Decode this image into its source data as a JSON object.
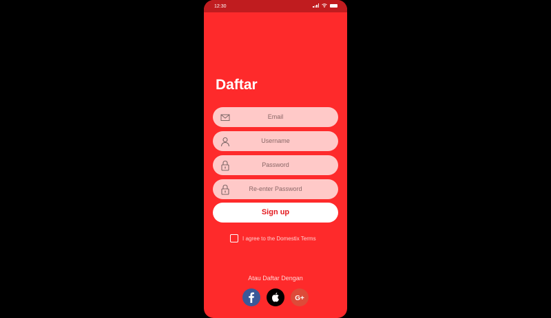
{
  "status": {
    "time": "12:30"
  },
  "screen": {
    "title": "Daftar"
  },
  "form": {
    "email_placeholder": "Email",
    "username_placeholder": "Username",
    "password_placeholder": "Password",
    "reenter_placeholder": "Re-enter Password",
    "signup_label": "Sign up",
    "agree_text": "I agree to the Domestix Terms"
  },
  "social": {
    "heading": "Atau Daftar Dengan",
    "icons": [
      "facebook-icon",
      "apple-icon",
      "google-plus-icon"
    ]
  },
  "colors": {
    "background": "#fe2a2b",
    "status_bar": "#c01c1f",
    "field": "#ffc9c8",
    "button_text": "#e3191e"
  }
}
